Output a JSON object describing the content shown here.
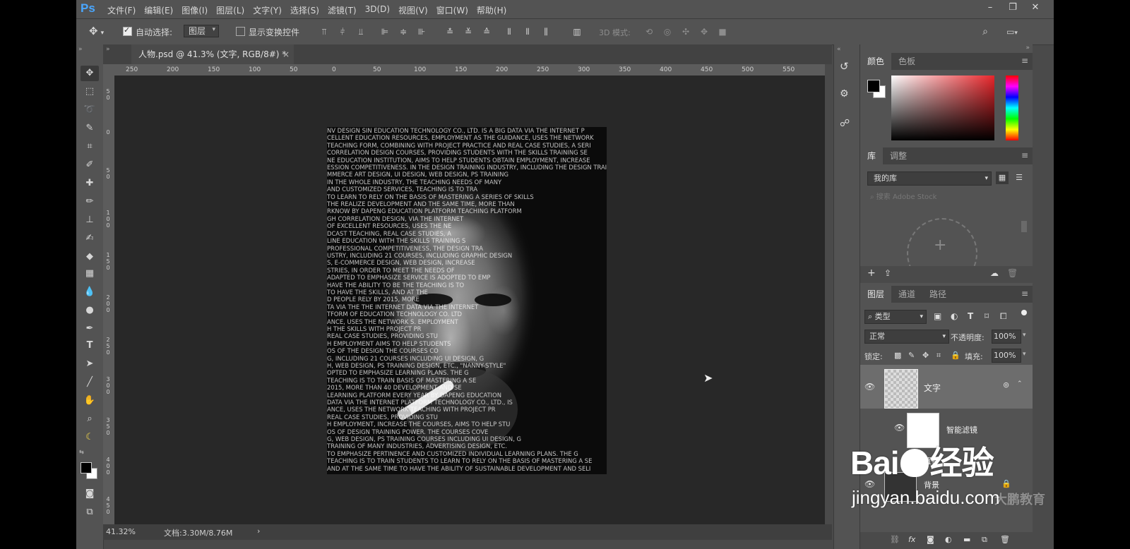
{
  "app": {
    "logo": "Ps",
    "menu": [
      "文件(F)",
      "编辑(E)",
      "图像(I)",
      "图层(L)",
      "文字(Y)",
      "选择(S)",
      "滤镜(T)",
      "3D(D)",
      "视图(V)",
      "窗口(W)",
      "帮助(H)"
    ],
    "window_controls": [
      "–",
      "❐",
      "✕"
    ]
  },
  "options": {
    "auto_select_label": "自动选择:",
    "auto_select_target": "图层",
    "show_transform_label": "显示变换控件",
    "mode_3d_label": "3D 模式:"
  },
  "document": {
    "tab_title": "人物.psd @ 41.3% (文字, RGB/8#) *",
    "tab_close": "×",
    "zoom": "41.32%",
    "doc_size": "文档:3.30M/8.76M",
    "status_arrow": "›",
    "ruler_h": [
      "250",
      "200",
      "150",
      "100",
      "50",
      "0",
      "50",
      "100",
      "150",
      "200",
      "250",
      "300",
      "350",
      "400",
      "450",
      "500",
      "550"
    ],
    "ruler_v": [
      "5 0",
      "0",
      "5 0",
      "1 0 0",
      "1 5 0",
      "2 0 0",
      "2 5 0",
      "3 0 0",
      "3 5 0",
      "4 0 0",
      "4 5 0",
      "5 0 0",
      "5 5 0",
      "6 0 0",
      "6 5 0",
      "7 0 0"
    ],
    "photo_text_lines": [
      "NV DESIGN SIN EDUCATION TECHNOLOGY CO., LTD. IS A BIG DATA VIA THE INTERNET P",
      "CELLENT EDUCATION RESOURCES, EMPLOYMENT AS THE GUIDANCE, USES THE NETWORK",
      "TEACHING FORM, COMBINING WITH PROJECT PRACTICE AND REAL CASE STUDIES, A SERI",
      "CORRELATION DESIGN COURSES, PROVIDING STUDENTS WITH THE SKILLS TRAINING SE",
      "NE EDUCATION INSTITUTION, AIMS TO HELP STUDENTS OBTAIN EMPLOYMENT, INCREASE",
      "ESSION COMPETITIVENESS. IN THE DESIGN TRAINING INDUSTRY, INCLUDING THE DESIGN TRAINING",
      "MMERCE ART DESIGN, UI DESIGN, WEB DESIGN, PS TRAINING",
      "IN THE WHOLE INDUSTRY, THE TEACHING NEEDS OF MANY",
      "AND CUSTOMIZED SERVICES, TEACHING IS TO TRA",
      "TO LEARN TO RELY ON THE BASIS OF MASTERING A SERIES OF SKILLS",
      "THE REALIZE DEVELOPMENT AND THE SAME TIME, MORE THAN",
      "RKNOW BY DAPENG EDUCATION PLATFORM TEACHING PLATFORM",
      "GH CORRELATION DESIGN, VIA THE INTERNET",
      "OF EXCELLENT RESOURCES, USES THE NE",
      "DCAST TEACHING, REAL CASE STUDIES, A",
      "LINE EDUCATION WITH THE SKILLS TRAINING S",
      "PROFESSIONAL COMPETITIVENESS, THE DESIGN TRA",
      "USTRY, INCLUDING 21 COURSES, INCLUDING GRAPHIC DESIGN",
      "S, E-COMMERCE DESIGN, WEB DESIGN, INCREASE",
      "STRIES, IN ORDER TO MEET THE NEEDS OF",
      "ADAPTED TO EMPHASIZE SERVICE IS ADOPTED TO EMP",
      "HAVE THE ABILITY TO BE THE TEACHING IS TO",
      "TO HAVE THE SKILLS, AND AT THE",
      "D PEOPLE RELY BY 2015, MORE",
      "TA VIA THE THE INTERNET DATA VIA THE INTERNET",
      "TFORM OF EDUCATION TECHNOLOGY CO. LTD",
      "ANCE, USES THE NETWORK S. EMPLOYMENT",
      "H THE SKILLS WITH PROJECT PR",
      "REAL CASE STUDIES, PROVIDING STU",
      "H EMPLOYMENT AIMS TO HELP STUDENTS",
      "OS OF THE DESIGN THE COURSES CO",
      "G, INCLUDING 21 COURSES INCLUDING UI DESIGN, G",
      "H, WEB DESIGN, PS TRAINING DESIGN, ETC., \"NANNY-STYLE\"",
      "OPTED TO EMPHASIZE LEARNING PLANS. THE G",
      "TEACHING IS TO TRAIN BASIS OF MASTERING A SE",
      "2015, MORE THAN 40 DEVELOPMENT AND SE",
      "LEARNING PLATFORM EVERY YEAR BY DAPENG EDUCATION",
      "DATA VIA THE INTERNET PLATFORM TECHNOLOGY CO., LTD., IS",
      "ANCE, USES THE NETWORK TEACHING WITH PROJECT PR",
      "REAL CASE STUDIES, PROVIDING STU",
      "H EMPLOYMENT, INCREASE THE COURSES, AIMS TO HELP STU",
      "OS OF DESIGN TRAINING POWER. THE COURSES COVE",
      "G, WEB DESIGN, PS TRAINING COURSES INCLUDING UI DESIGN, G",
      "TRAINING OF MANY INDUSTRIES, ADVERTISING DESIGN, ETC.",
      "TO EMPHASIZE PERTINENCE AND CUSTOMIZED INDIVIDUAL LEARNING PLANS. THE G",
      "TEACHING IS TO TRAIN STUDENTS TO LEARN TO RELY ON THE BASIS OF MASTERING A SE",
      "AND AT THE SAME TIME TO HAVE THE ABILITY OF SUSTAINABLE DEVELOPMENT AND SELI"
    ]
  },
  "tools": [
    "move",
    "marquee",
    "lasso",
    "quick-select",
    "crop",
    "eyedropper",
    "healing",
    "brush",
    "stamp",
    "history-brush",
    "eraser",
    "gradient",
    "blur",
    "dodge",
    "pen",
    "type",
    "path-select",
    "line",
    "hand",
    "zoom",
    "banana",
    "colors",
    "quickmask",
    "screen-mode"
  ],
  "color_panel": {
    "tabs": [
      "颜色",
      "色板"
    ],
    "fg": "#000000",
    "bg": "#ffffff",
    "hue": "#e8262b"
  },
  "library_panel": {
    "tabs": [
      "库",
      "调整"
    ],
    "library_name": "我的库",
    "search_placeholder": "搜索 Adobe Stock"
  },
  "layers_panel": {
    "tabs": [
      "图层",
      "通道",
      "路径"
    ],
    "filter_kind": "类型",
    "blend_mode": "正常",
    "opacity_label": "不透明度:",
    "opacity_value": "100%",
    "lock_label": "锁定:",
    "fill_label": "填充:",
    "fill_value": "100%",
    "layers": [
      {
        "name": "文字",
        "selected": true
      },
      {
        "name": "智能滤镜",
        "selected": false
      },
      {
        "name": "置换",
        "selected": false
      },
      {
        "name": "背景",
        "selected": false
      }
    ]
  },
  "watermark": {
    "brand_text": "Bai",
    "brand_suffix": "经验",
    "url": "jingyan.baidu.com",
    "extra": "大鹏教育"
  }
}
